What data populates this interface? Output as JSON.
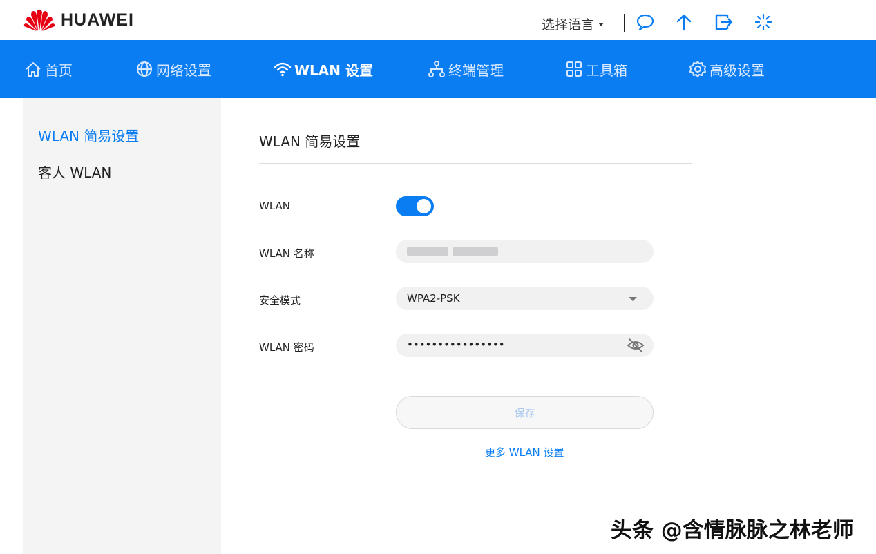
{
  "header": {
    "brand": "HUAWEI",
    "language_label": "选择语言",
    "icons": [
      "chat-icon",
      "upload-icon",
      "logout-icon",
      "loading-icon"
    ]
  },
  "nav": {
    "items": [
      {
        "label": "首页",
        "icon": "home-icon",
        "active": false
      },
      {
        "label": "网络设置",
        "icon": "globe-icon",
        "active": false
      },
      {
        "label": "WLAN 设置",
        "icon": "wifi-icon",
        "active": true
      },
      {
        "label": "终端管理",
        "icon": "devices-icon",
        "active": false
      },
      {
        "label": "工具箱",
        "icon": "grid-icon",
        "active": false
      },
      {
        "label": "高级设置",
        "icon": "gear-icon",
        "active": false
      }
    ]
  },
  "sidebar": {
    "items": [
      {
        "label": "WLAN 简易设置",
        "active": true
      },
      {
        "label": "客人 WLAN",
        "active": false
      }
    ]
  },
  "main": {
    "title": "WLAN 简易设置",
    "wlan_label": "WLAN",
    "wlan_enabled": true,
    "ssid_label": "WLAN 名称",
    "security_label": "安全模式",
    "security_value": "WPA2-PSK",
    "password_label": "WLAN 密码",
    "password_masked": "••••••••••••••••",
    "save_label": "保存",
    "more_link": "更多 WLAN 设置"
  },
  "watermark": "头条 @含情脉脉之林老师",
  "colors": {
    "accent": "#0a7df3",
    "sidebar_bg": "#f4f4f5",
    "field_bg": "#f1f1f2"
  }
}
